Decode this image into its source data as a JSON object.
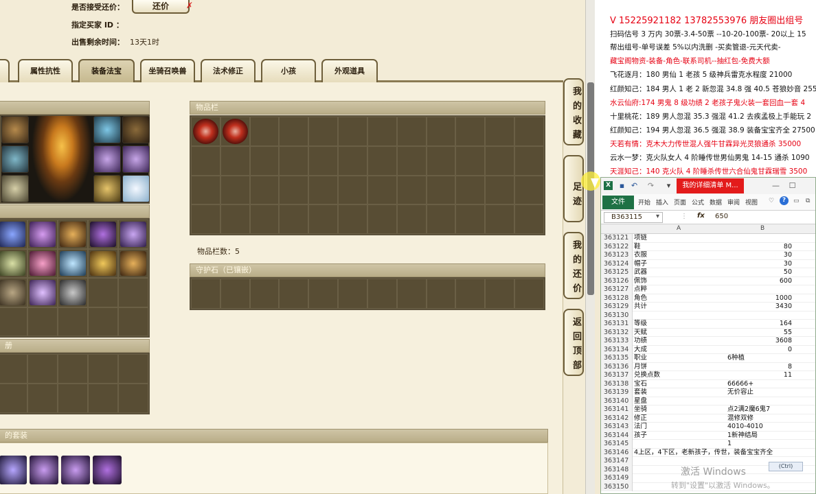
{
  "game": {
    "info": {
      "accept_offer_label": "是否接受还价：",
      "counter_button": "还价",
      "buyer_id_label": "指定买家 ID ：",
      "remaining_label": "出售剩余时间：",
      "remaining_value": "13天1时"
    },
    "tabs": [
      {
        "label": "属性抗性"
      },
      {
        "label": "装备法宝"
      },
      {
        "label": "坐骑召唤兽"
      },
      {
        "label": "法术修正"
      },
      {
        "label": "小孩"
      },
      {
        "label": "外观道具"
      }
    ],
    "inventory": {
      "title": "物品栏",
      "count_label": "物品栏数：5"
    },
    "guard_stone": {
      "title": "守护石（已镶嵌）"
    },
    "left_panels": {
      "book_fragment": "册",
      "set_fragment": "的套装"
    },
    "side_buttons": [
      {
        "label": "我的收藏"
      },
      {
        "label": "足迹"
      },
      {
        "label": "我的还价"
      },
      {
        "label": "返回顶部"
      }
    ]
  },
  "ads": {
    "lines": [
      {
        "text": "V 15225921182   13782553976 朋友圈出组号",
        "color": "red"
      },
      {
        "text": "扫码估号 3 万内 30票-3.4-50票  --10-20-100票- 20以上 15",
        "color": "black"
      },
      {
        "text": "帮出组号-单号误差 5%以内洗删 -买卖管退-元天代卖-",
        "color": "black"
      },
      {
        "text": "藏宝阁物资-装备-角色-联系司机--抽红包-免费大额",
        "color": "red"
      },
      {
        "text": "飞花逐月：180 男仙 1 老孩 5 级神兵雷克水程度 21000",
        "color": "black"
      },
      {
        "text": "红颜知己：184 男人 1 老 2 新忽混 34.8 强 40.5 苍狼妙音 255",
        "color": "black"
      },
      {
        "text": "水云仙府:174 男鬼 8 级功绩 2 老孩子鬼火装一套回血一套 4",
        "color": "red"
      },
      {
        "text": "十里桃花：189 男人忽混 35.3 强混 41.2 去疾孟极上手能玩 2",
        "color": "black"
      },
      {
        "text": "红颜知己：194 男人忽混 36.5 强混 38.9 装备宝宝齐全 27500",
        "color": "black"
      },
      {
        "text": "天若有情：克木大力传世混人强牛甘霖异光灵狼通杀 35000",
        "color": "red"
      },
      {
        "text": "云水一梦：克火队女人 4 阶睡传世男仙男鬼 14-15 通杀 1090",
        "color": "black"
      },
      {
        "text": "天涯知己：140 克火队 4 阶睡杀传世六合仙鬼甘霖瑞雪 3500",
        "color": "red"
      }
    ]
  },
  "excel": {
    "title_tab": "我的详细清单 M...",
    "file_tab": "文件",
    "ribbon_tabs": [
      "开始",
      "插入",
      "页面",
      "公式",
      "数据",
      "审阅",
      "视图"
    ],
    "name_box": "B363115",
    "fx": "fx",
    "formula_value": "650",
    "col_a": "A",
    "col_b": "B",
    "rows": [
      {
        "n": "363121",
        "a": "项链",
        "b": ""
      },
      {
        "n": "363122",
        "a": "鞋",
        "b": "80"
      },
      {
        "n": "363123",
        "a": "衣服",
        "b": "30"
      },
      {
        "n": "363124",
        "a": "帽子",
        "b": "30"
      },
      {
        "n": "363125",
        "a": "武器",
        "b": "50"
      },
      {
        "n": "363126",
        "a": "佩饰",
        "b": "600"
      },
      {
        "n": "363127",
        "a": "点粹",
        "b": ""
      },
      {
        "n": "363128",
        "a": "角色",
        "b": "1000"
      },
      {
        "n": "363129",
        "a": "共计",
        "b": "3430"
      },
      {
        "n": "363130",
        "a": "",
        "b": ""
      },
      {
        "n": "363131",
        "a": "等级",
        "b": "164"
      },
      {
        "n": "363132",
        "a": "天赋",
        "b": "55"
      },
      {
        "n": "363133",
        "a": "功绩",
        "b": "3608"
      },
      {
        "n": "363134",
        "a": "大成",
        "b": "0"
      },
      {
        "n": "363135",
        "a": "职业",
        "b": "6种植"
      },
      {
        "n": "363136",
        "a": "月饼",
        "b": "8"
      },
      {
        "n": "363137",
        "a": "兑换点数",
        "b": "11"
      },
      {
        "n": "363138",
        "a": "宝石",
        "b": "66666+"
      },
      {
        "n": "363139",
        "a": "套装",
        "b": "无价容止"
      },
      {
        "n": "363140",
        "a": "星盘",
        "b": ""
      },
      {
        "n": "363141",
        "a": "坐骑",
        "b": "点2满2魔6鬼7"
      },
      {
        "n": "363142",
        "a": "修正",
        "b": "混修双修"
      },
      {
        "n": "363143",
        "a": "法门",
        "b": "4010-4010"
      },
      {
        "n": "363144",
        "a": "孩子",
        "b": "1新神结局"
      },
      {
        "n": "363145",
        "a": "",
        "b": "1"
      },
      {
        "n": "363146",
        "a": "4上区，4下区，老新孩子，传世，装备宝宝齐全",
        "b": ""
      },
      {
        "n": "363147",
        "a": "",
        "b": ""
      },
      {
        "n": "363148",
        "a": "",
        "b": ""
      },
      {
        "n": "363149",
        "a": "",
        "b": ""
      },
      {
        "n": "363150",
        "a": "",
        "b": ""
      }
    ],
    "popup_tag": "(Ctrl)",
    "watermark_title": "激活 Windows",
    "watermark_sub": "转到\"设置\"以激活 Windows。"
  }
}
